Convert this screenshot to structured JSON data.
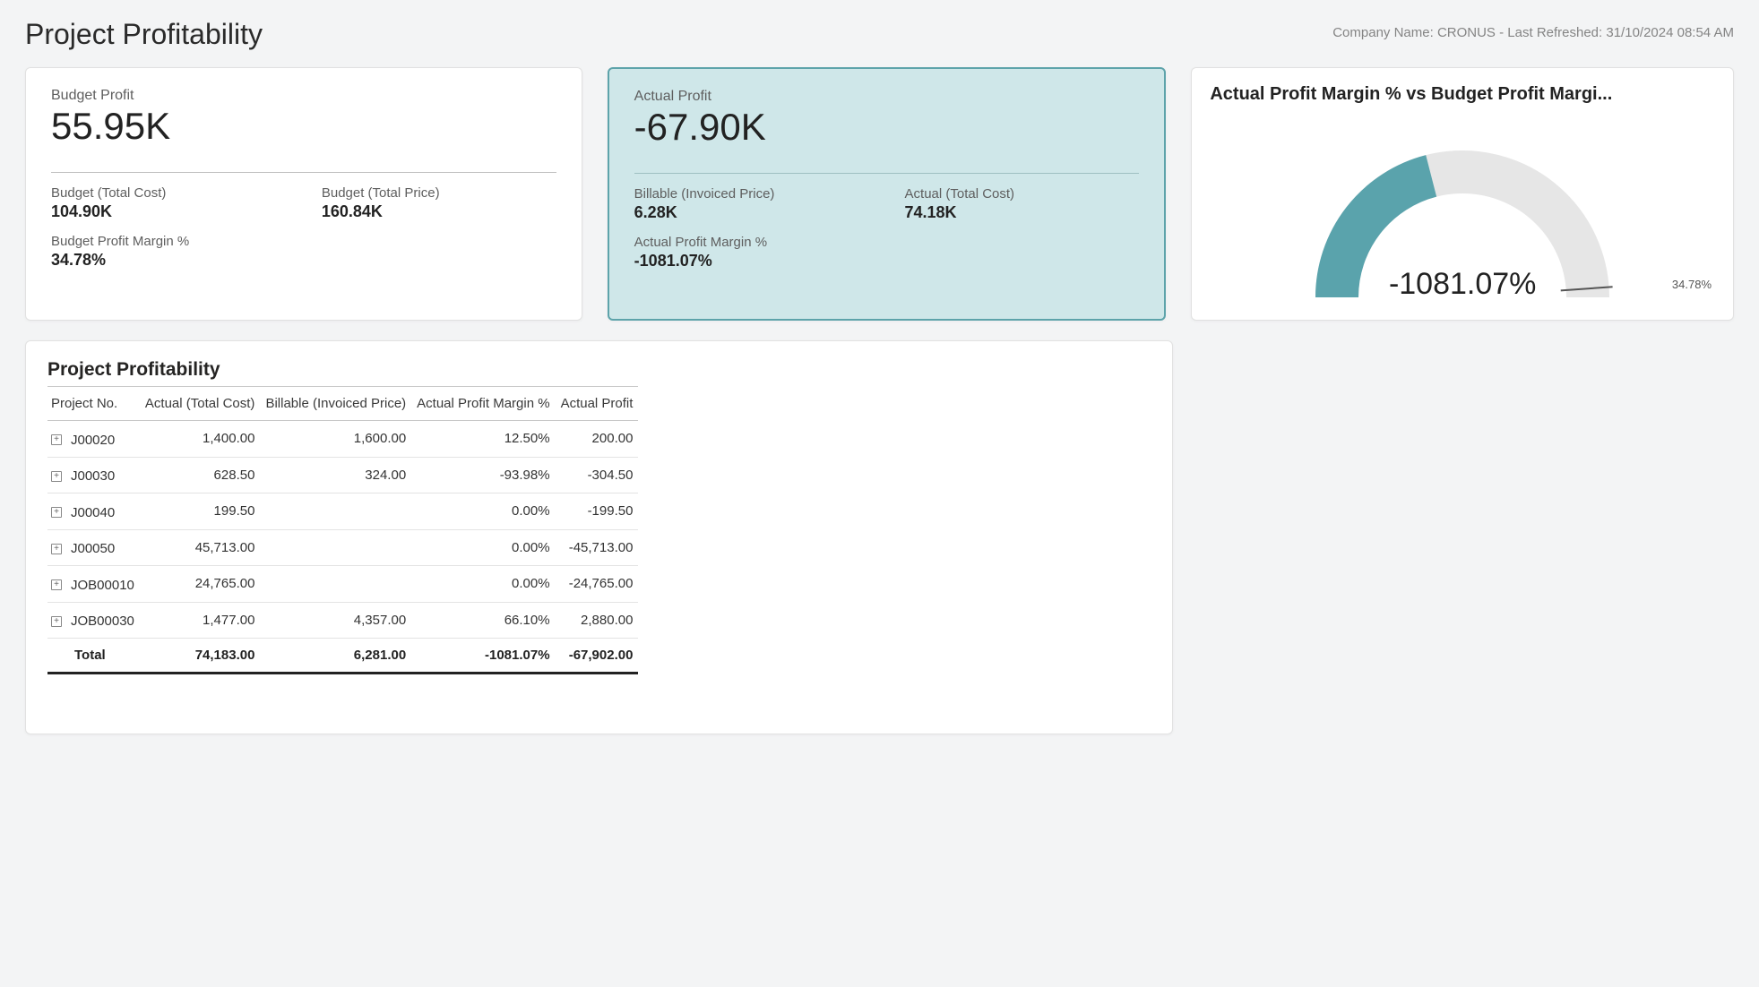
{
  "header": {
    "title": "Project Profitability",
    "company_label": "Company Name:",
    "company_name": "CRONUS",
    "refreshed_label": "Last Refreshed:",
    "refreshed_at": "31/10/2024 08:54 AM"
  },
  "budget_card": {
    "profit_label": "Budget Profit",
    "profit_value": "55.95K",
    "cost_label": "Budget (Total Cost)",
    "cost_value": "104.90K",
    "price_label": "Budget (Total Price)",
    "price_value": "160.84K",
    "margin_label": "Budget Profit Margin %",
    "margin_value": "34.78%"
  },
  "actual_card": {
    "profit_label": "Actual Profit",
    "profit_value": "-67.90K",
    "billable_label": "Billable (Invoiced Price)",
    "billable_value": "6.28K",
    "cost_label": "Actual (Total Cost)",
    "cost_value": "74.18K",
    "margin_label": "Actual Profit Margin %",
    "margin_value": "-1081.07%"
  },
  "gauge": {
    "title": "Actual Profit Margin % vs Budget Profit Margi...",
    "center_value": "-1081.07%",
    "target_label": "34.78%",
    "fill_color": "#5aa3ac",
    "track_color": "#e6e6e6",
    "fill_fraction": 0.42
  },
  "table": {
    "title": "Project Profitability",
    "columns": [
      "Project No.",
      "Actual (Total Cost)",
      "Billable (Invoiced Price)",
      "Actual Profit Margin %",
      "Actual Profit"
    ],
    "rows": [
      {
        "project": "J00020",
        "cost": "1,400.00",
        "billable": "1,600.00",
        "margin": "12.50%",
        "profit": "200.00"
      },
      {
        "project": "J00030",
        "cost": "628.50",
        "billable": "324.00",
        "margin": "-93.98%",
        "profit": "-304.50"
      },
      {
        "project": "J00040",
        "cost": "199.50",
        "billable": "",
        "margin": "0.00%",
        "profit": "-199.50"
      },
      {
        "project": "J00050",
        "cost": "45,713.00",
        "billable": "",
        "margin": "0.00%",
        "profit": "-45,713.00"
      },
      {
        "project": "JOB00010",
        "cost": "24,765.00",
        "billable": "",
        "margin": "0.00%",
        "profit": "-24,765.00"
      },
      {
        "project": "JOB00030",
        "cost": "1,477.00",
        "billable": "4,357.00",
        "margin": "66.10%",
        "profit": "2,880.00"
      }
    ],
    "total": {
      "label": "Total",
      "cost": "74,183.00",
      "billable": "6,281.00",
      "margin": "-1081.07%",
      "profit": "-67,902.00"
    }
  },
  "chart_data": {
    "type": "gauge",
    "title": "Actual Profit Margin % vs Budget Profit Margin %",
    "value": -1081.07,
    "target": 34.78,
    "unit": "%",
    "notes": "Semi-circular gauge; teal fill covers roughly 42% of the arc from the left; target marker at right end labelled 34.78%."
  }
}
